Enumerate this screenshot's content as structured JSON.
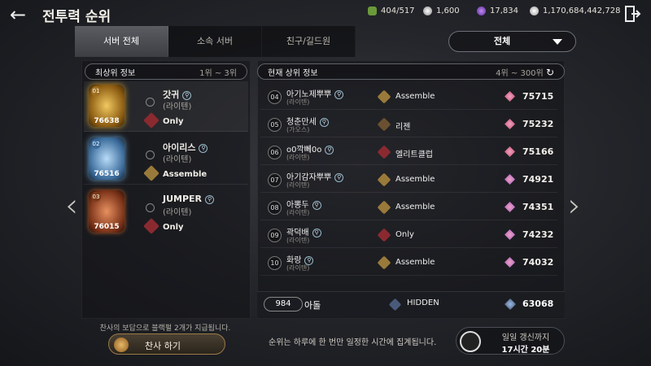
{
  "header": {
    "title": "전투력 순위",
    "currencies": [
      {
        "icon": "green-gem-icon",
        "value": "404/517",
        "color": "#6a9a3a"
      },
      {
        "icon": "silver-coin-icon",
        "value": "1,600",
        "color": "#d8d8d8"
      },
      {
        "icon": "purple-gem-icon",
        "value": "17,834",
        "color": "#8a4ad0"
      },
      {
        "icon": "adena-coin-icon",
        "value": "1,170,684,442,728",
        "color": "#e0e0e0"
      }
    ]
  },
  "tabs": [
    "서버 전체",
    "소속 서버",
    "친구/길드원"
  ],
  "filter": {
    "selected": "전체"
  },
  "top_panel": {
    "title": "최상위 정보",
    "range": "1위 ~ 3위"
  },
  "current_panel": {
    "title": "현재 상위 정보",
    "range": "4위 ~ 300위"
  },
  "top3": [
    {
      "rank": "01",
      "score": "76638",
      "name": "갓귀",
      "server": "(라이텐)",
      "guild": "Only",
      "color": "#c89a30"
    },
    {
      "rank": "02",
      "score": "76516",
      "name": "아이리스",
      "server": "(라이텐)",
      "guild": "Assemble",
      "color": "#6aa0c8"
    },
    {
      "rank": "03",
      "score": "76015",
      "name": "JUMPER",
      "server": "(라이텐)",
      "guild": "Only",
      "color": "#b8602a"
    }
  ],
  "rankings": [
    {
      "rank": "04",
      "name": "아기노제뿌뿌",
      "server": "(라이텐)",
      "guild": "Assemble",
      "score": "75715"
    },
    {
      "rank": "05",
      "name": "청춘만세",
      "server": "(가오스)",
      "guild": "리젠",
      "score": "75232"
    },
    {
      "rank": "06",
      "name": "o0깍뻬0o",
      "server": "(라이텐)",
      "guild": "엘리트클럽",
      "score": "75166"
    },
    {
      "rank": "07",
      "name": "아기감자뿌뿌",
      "server": "(라이텐)",
      "guild": "Assemble",
      "score": "74921"
    },
    {
      "rank": "08",
      "name": "아뽕두",
      "server": "(라이텐)",
      "guild": "Assemble",
      "score": "74351"
    },
    {
      "rank": "09",
      "name": "곽덕배",
      "server": "(라이텐)",
      "guild": "Only",
      "score": "74232"
    },
    {
      "rank": "10",
      "name": "화랑",
      "server": "(라이텐)",
      "guild": "Assemble",
      "score": "74032"
    }
  ],
  "my_rank": {
    "rank": "984",
    "name": "아돌",
    "guild": "HIDDEN",
    "score": "63068"
  },
  "cheer": {
    "notice": "찬사의 보답으로 블랙펄 2개가 지급됩니다.",
    "button": "찬사 하기"
  },
  "footer_notice": "순위는 하루에 한 번만 일정한 시간에 집계됩니다.",
  "timer": {
    "label": "일일 갱신까지",
    "value": "17시간 20분"
  }
}
